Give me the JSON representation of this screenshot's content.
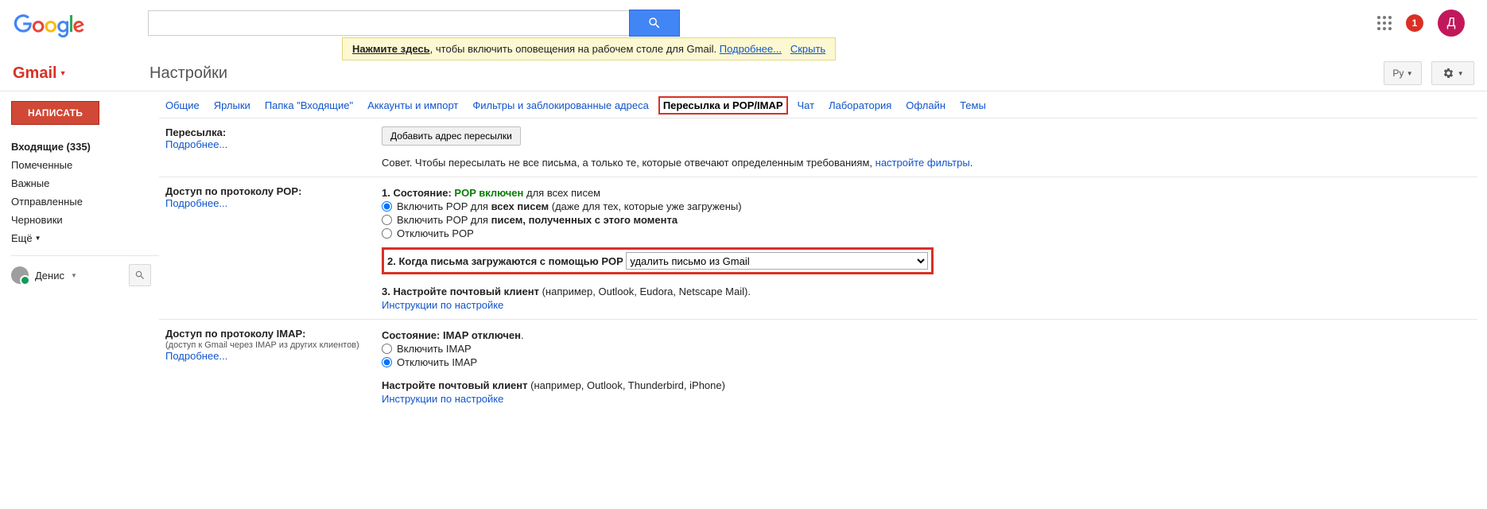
{
  "header": {
    "notif_count": "1",
    "avatar_letter": "Д"
  },
  "notice": {
    "cta": "Нажмите здесь",
    "text": ", чтобы включить оповещения на рабочем столе для Gmail.   ",
    "more": "Подробнее...",
    "hide": "Скрыть"
  },
  "brand": "Gmail",
  "page_title": "Настройки",
  "lang_label": "Ру",
  "sidebar": {
    "compose": "НАПИСАТЬ",
    "items": [
      {
        "label": "Входящие (335)",
        "bold": true
      },
      {
        "label": "Помеченные"
      },
      {
        "label": "Важные"
      },
      {
        "label": "Отправленные"
      },
      {
        "label": "Черновики"
      }
    ],
    "more": "Ещё",
    "user": "Денис"
  },
  "tabs": [
    "Общие",
    "Ярлыки",
    "Папка \"Входящие\"",
    "Аккаунты и импорт",
    "Фильтры и заблокированные адреса",
    "Пересылка и POP/IMAP",
    "Чат",
    "Лаборатория",
    "Офлайн",
    "Темы"
  ],
  "active_tab": 5,
  "forwarding": {
    "label": "Пересылка:",
    "more": "Подробнее...",
    "add_btn": "Добавить адрес пересылки",
    "tip_prefix": "Совет. Чтобы пересылать не все письма, а только те, которые отвечают определенным требованиям, ",
    "tip_link": "настройте фильтры",
    "tip_suffix": "."
  },
  "pop": {
    "label": "Доступ по протоколу POP:",
    "more": "Подробнее...",
    "s1_prefix": "1. Состояние: ",
    "s1_state": "POP включен",
    "s1_suffix": " для всех писем",
    "opt1_a": "Включить POP для ",
    "opt1_b": "всех писем",
    "opt1_c": " (даже для тех, которые уже загружены)",
    "opt2_a": "Включить POP для ",
    "opt2_b": "писем, полученных с этого момента",
    "opt3": "Отключить POP",
    "s2": "2. Когда письма загружаются с помощью POP",
    "select": "удалить письмо из Gmail",
    "s3_a": "3. Настройте почтовый клиент",
    "s3_b": " (например, Outlook, Eudora, Netscape Mail).",
    "s3_link": "Инструкции по настройке"
  },
  "imap": {
    "label": "Доступ по протоколу IMAP:",
    "sub": "(доступ к Gmail через IMAP из других клиентов)",
    "more": "Подробнее...",
    "state_a": "Состояние: ",
    "state_b": "IMAP отключен",
    "state_c": ".",
    "opt1": "Включить IMAP",
    "opt2": "Отключить IMAP",
    "cfg_a": "Настройте почтовый клиент",
    "cfg_b": " (например, Outlook, Thunderbird, iPhone)",
    "cfg_link": "Инструкции по настройке"
  }
}
